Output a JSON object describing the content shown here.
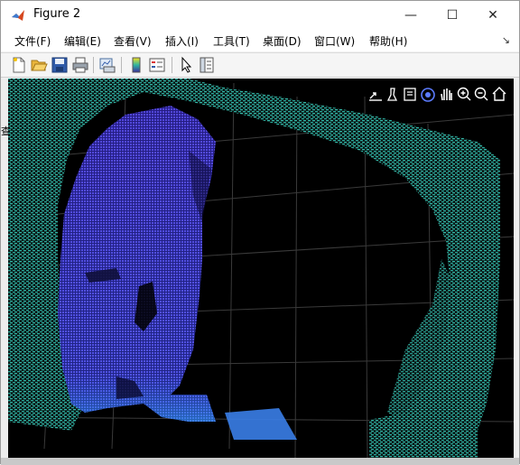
{
  "window": {
    "title": "Figure 2",
    "minimize_label": "—",
    "maximize_label": "☐",
    "close_label": "✕"
  },
  "menu": {
    "items": [
      {
        "label": "文件(F)"
      },
      {
        "label": "编辑(E)"
      },
      {
        "label": "查看(V)"
      },
      {
        "label": "插入(I)"
      },
      {
        "label": "工具(T)"
      },
      {
        "label": "桌面(D)"
      },
      {
        "label": "窗口(W)"
      },
      {
        "label": "帮助(H)"
      }
    ],
    "dock_glyph": "↘"
  },
  "side": {
    "glyph": "查"
  },
  "toolbar": {
    "buttons": [
      "new-figure",
      "open-file",
      "save",
      "print",
      "link-plot",
      "insert-colorbar",
      "insert-legend",
      "edit-plot",
      "property-inspector"
    ]
  },
  "axes_toolbar": {
    "buttons": [
      "export-icon",
      "brush-icon",
      "data-tips-icon",
      "rotate-3d-icon",
      "pan-icon",
      "zoom-in-icon",
      "zoom-out-icon",
      "home-icon"
    ]
  },
  "colors": {
    "background": "#000000",
    "grid": "#3a3a3a",
    "wall_points": "#2aa89a",
    "face_points_near": "#4f46e0",
    "face_points_far": "#2b8fe8"
  }
}
